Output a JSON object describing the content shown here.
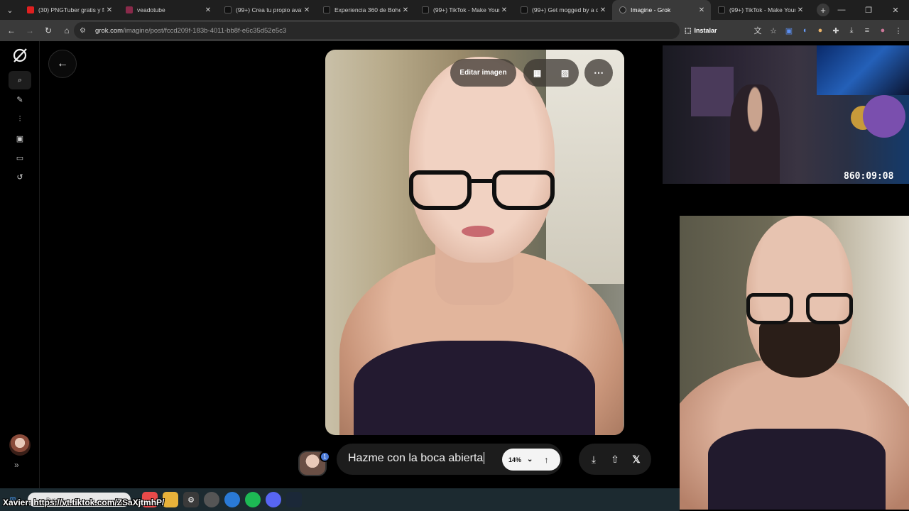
{
  "browser": {
    "tabs": [
      {
        "title": "(30) PNGTuber gratis y fá",
        "color": "#e02020",
        "active": false
      },
      {
        "title": "veadotube",
        "color": "#8a2a4a",
        "active": false
      },
      {
        "title": "(99+) Crea tu propio avata",
        "color": "#111111",
        "active": false
      },
      {
        "title": "Experiencia 360 de Bohem",
        "color": "#111111",
        "active": false
      },
      {
        "title": "(99+) TikTok - Make Your",
        "color": "#111111",
        "active": false
      },
      {
        "title": "(99+) Get mogged by a dr",
        "color": "#111111",
        "active": false
      },
      {
        "title": "Imagine - Grok",
        "color": "#222222",
        "active": true
      },
      {
        "title": "(99+) TikTok - Make Your",
        "color": "#111111",
        "active": false
      }
    ],
    "new_tab": "+",
    "url_host": "grok.com",
    "url_path": "/imagine/post/fccd209f-183b-4011-bb8f-e6c35d52e5c3",
    "install_label": "Instalar"
  },
  "image_toolbar": {
    "edit_label": "Editar imagen"
  },
  "prompt": {
    "text": "Hazme con la boca abierta",
    "badge": "1",
    "percent": "14%"
  },
  "stream": {
    "timer": "860:09:08",
    "overlay_link": "Xavier: https://vt.tiktok.com/ZSaXjtmhP/"
  },
  "taskbar": {
    "search_placeholder": "Buscar"
  },
  "colors": {
    "background": "#000000",
    "tabbar": "#1f1f1f",
    "toolbar": "#3a3a3a",
    "prompt_pill": "#f4f4f4",
    "badge": "#4a79d6"
  }
}
